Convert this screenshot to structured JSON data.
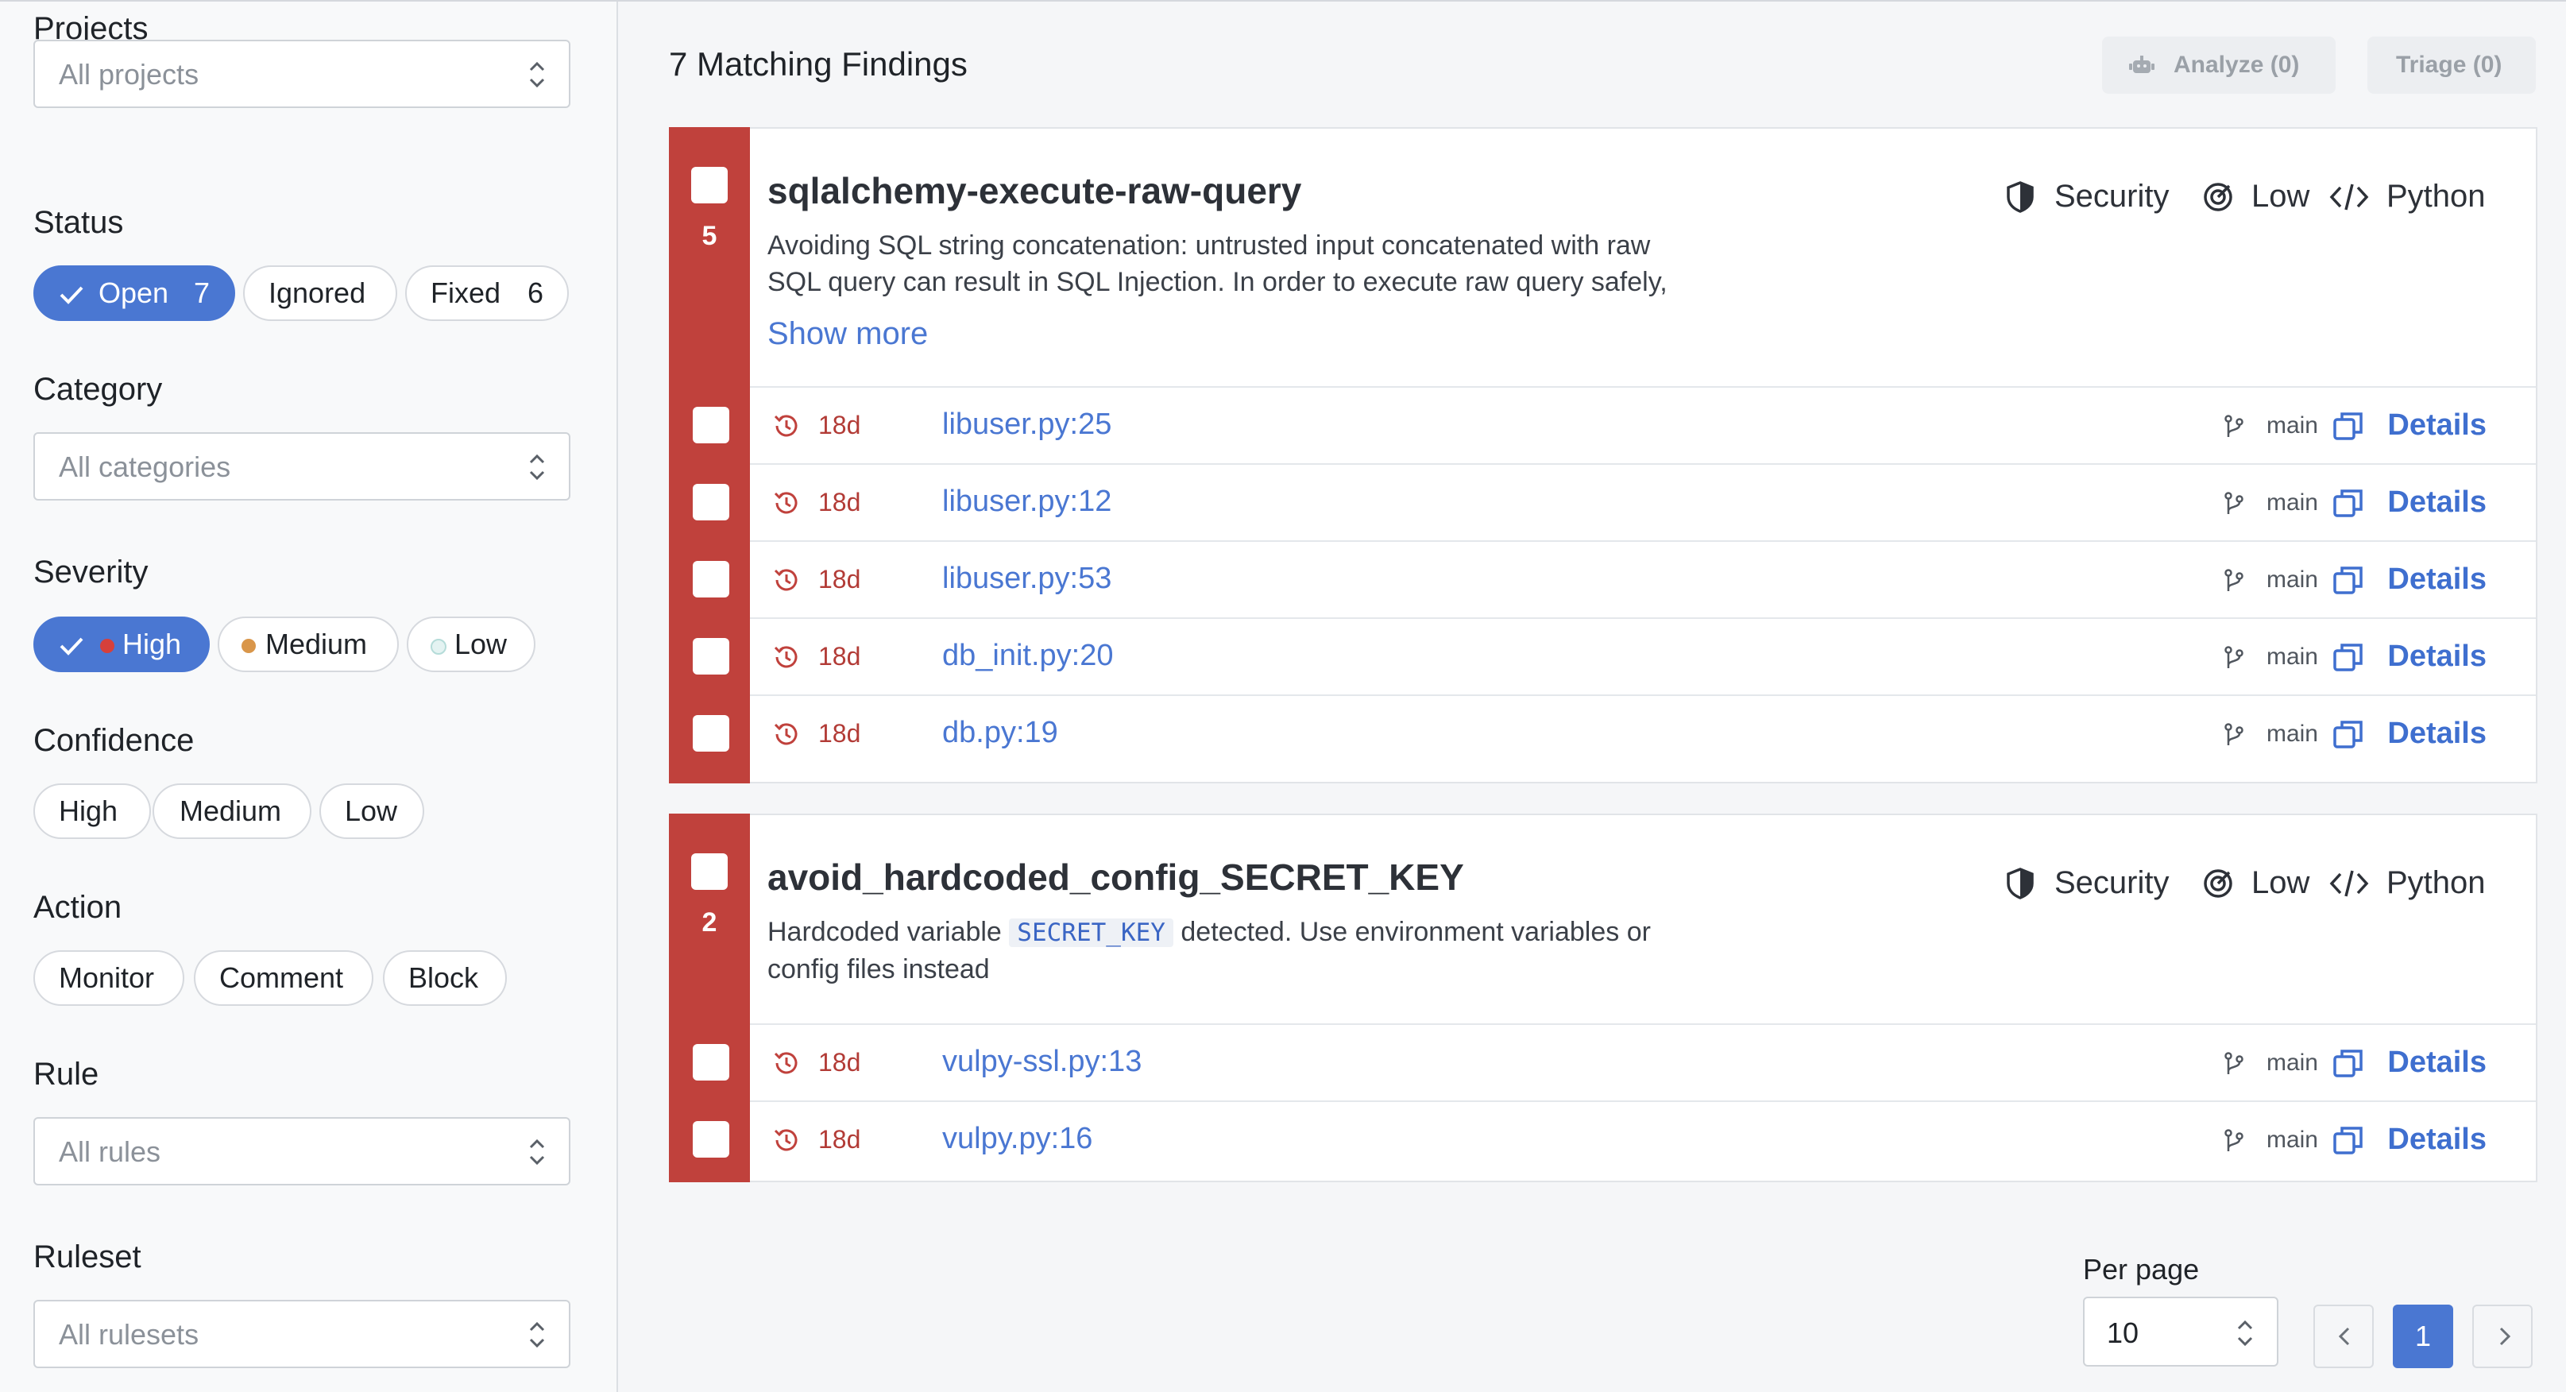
{
  "sidebar": {
    "projects": {
      "label": "Projects",
      "placeholder": "All projects"
    },
    "status": {
      "label": "Status",
      "options": [
        {
          "label": "Open",
          "count": "7",
          "active": true
        },
        {
          "label": "Ignored",
          "active": false
        },
        {
          "label": "Fixed",
          "count": "6",
          "active": false
        }
      ]
    },
    "category": {
      "label": "Category",
      "placeholder": "All categories"
    },
    "severity": {
      "label": "Severity",
      "options": [
        {
          "label": "High",
          "active": true,
          "dot_color": "#d6403b"
        },
        {
          "label": "Medium",
          "active": false,
          "dot_color": "#d9964a"
        },
        {
          "label": "Low",
          "active": false,
          "dot_color": "#bfe3e0"
        }
      ]
    },
    "confidence": {
      "label": "Confidence",
      "options": [
        "High",
        "Medium",
        "Low"
      ]
    },
    "action": {
      "label": "Action",
      "options": [
        "Monitor",
        "Comment",
        "Block"
      ]
    },
    "rule": {
      "label": "Rule",
      "placeholder": "All rules"
    },
    "ruleset": {
      "label": "Ruleset",
      "placeholder": "All rulesets"
    }
  },
  "header": {
    "title": "7 Matching Findings",
    "analyze_label": "Analyze (0)",
    "triage_label": "Triage (0)"
  },
  "findings": [
    {
      "count": "5",
      "title": "sqlalchemy-execute-raw-query",
      "description_line1": "Avoiding SQL string concatenation: untrusted input concatenated with raw",
      "description_line2": "SQL query can result in SQL Injection. In order to execute raw query safely,",
      "show_more": "Show more",
      "category": "Security",
      "confidence": "Low",
      "language": "Python",
      "rows": [
        {
          "age": "18d",
          "file": "libuser.py:25",
          "branch": "main",
          "details": "Details"
        },
        {
          "age": "18d",
          "file": "libuser.py:12",
          "branch": "main",
          "details": "Details"
        },
        {
          "age": "18d",
          "file": "libuser.py:53",
          "branch": "main",
          "details": "Details"
        },
        {
          "age": "18d",
          "file": "db_init.py:20",
          "branch": "main",
          "details": "Details"
        },
        {
          "age": "18d",
          "file": "db.py:19",
          "branch": "main",
          "details": "Details"
        }
      ]
    },
    {
      "count": "2",
      "title": "avoid_hardcoded_config_SECRET_KEY",
      "description_pre": "Hardcoded variable",
      "description_code": "SECRET_KEY",
      "description_post": "detected. Use environment variables or",
      "description_line2": "config files instead",
      "category": "Security",
      "confidence": "Low",
      "language": "Python",
      "rows": [
        {
          "age": "18d",
          "file": "vulpy-ssl.py:13",
          "branch": "main",
          "details": "Details"
        },
        {
          "age": "18d",
          "file": "vulpy.py:16",
          "branch": "main",
          "details": "Details"
        }
      ]
    }
  ],
  "pagination": {
    "per_page_label": "Per page",
    "per_page_value": "10",
    "current_page": "1"
  },
  "colors": {
    "accent": "#4a77d2",
    "severity_high": "#c0413c"
  }
}
